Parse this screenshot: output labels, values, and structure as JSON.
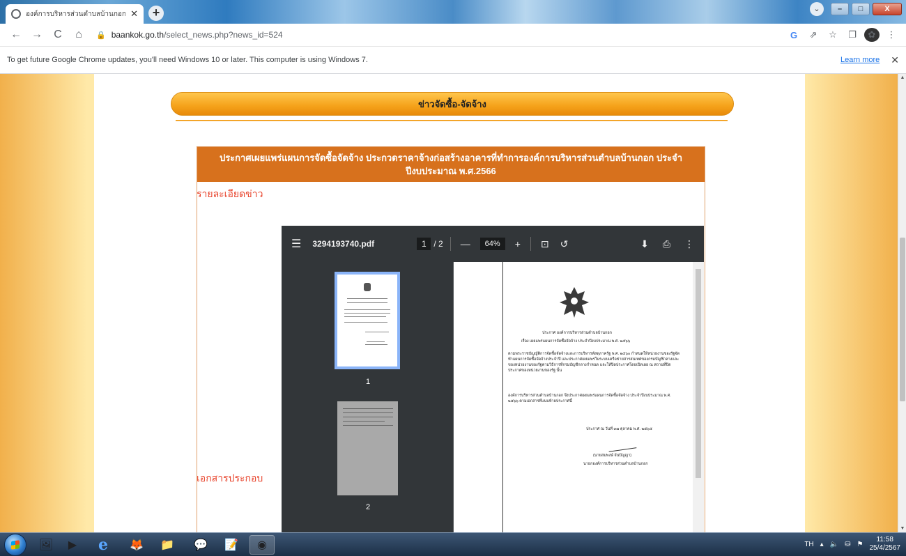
{
  "tab": {
    "title": "องค์การบริหารส่วนตำบลบ้านกอก อำเ",
    "close": "✕",
    "new": "+"
  },
  "window": {
    "minimize": "–",
    "maximize": "□",
    "close": "X",
    "list": "⌄"
  },
  "toolbar": {
    "back": "←",
    "forward": "→",
    "reload": "C",
    "home": "⌂",
    "url_host": "baankok.go.th",
    "url_path": "/select_news.php?news_id=524",
    "google": "G",
    "share": "⇗",
    "star": "☆",
    "sidebar": "❐",
    "menu": "⋮"
  },
  "infobar": {
    "message": "To get future Google Chrome updates, you'll need Windows 10 or later. This computer is using Windows 7.",
    "learn_more": "Learn more",
    "close": "✕"
  },
  "page": {
    "banner": "ข่าวจัดซื้อ-จัดจ้าง",
    "news_title": "ประกาศเผยแพร่แผนการจัดซื้อจัดจ้าง ประกวดราคาจ้างก่อสร้างอาคารที่ทำการองค์การบริหารส่วนตำบลบ้านกอก ประจำปีงบประมาณ พ.ศ.2566",
    "detail_label": "รายละเอียดข่าว",
    "attachment_label": "เอกสารประกอบ"
  },
  "pdf": {
    "filename": "3294193740.pdf",
    "current_page": "1",
    "total_pages": "/ 2",
    "zoom": "64%",
    "zoom_out": "—",
    "zoom_in": "+",
    "thumb_labels": [
      "1",
      "2"
    ],
    "doc": {
      "heading": "ประกาศ องค์การบริหารส่วนตำบลบ้านกอก",
      "subject": "เรื่อง เผยแพร่แผนการจัดซื้อจัดจ้าง ประจำปีงบประมาณ พ.ศ. ๒๕๖๖",
      "para1": "ตามพระราชบัญญัติการจัดซื้อจัดจ้างและการบริหารพัสดุภาครัฐ พ.ศ. ๒๕๖๐ กำหนดให้หน่วยงานของรัฐจัดทำแผนการจัดซื้อจัดจ้างประจำปี และประกาศเผยแพร่ในระบบเครือข่ายสารสนเทศของกรมบัญชีกลางและของหน่วยงานของรัฐตามวิธีการที่กรมบัญชีกลางกำหนด และให้ปิดประกาศโดยเปิดเผย ณ สถานที่ปิดประกาศของหน่วยงานของรัฐ นั้น",
      "para2": "องค์การบริหารส่วนตำบลบ้านกอก จึงประกาศเผยแพร่แผนการจัดซื้อจัดจ้าง ประจำปีงบประมาณ พ.ศ. ๒๕๖๖ ตามเอกสารที่แนบท้ายประกาศนี้",
      "date": "ประกาศ ณ วันที่ ๓๗ ตุลาคม พ.ศ. ๒๕๖๕",
      "signer": "(นายสมพงษ์ จันปัญญา)",
      "position": "นายกองค์การบริหารส่วนตำบลบ้านกอก"
    }
  },
  "taskbar": {
    "lang": "TH",
    "time": "11:58",
    "date": "25/4/2567"
  }
}
